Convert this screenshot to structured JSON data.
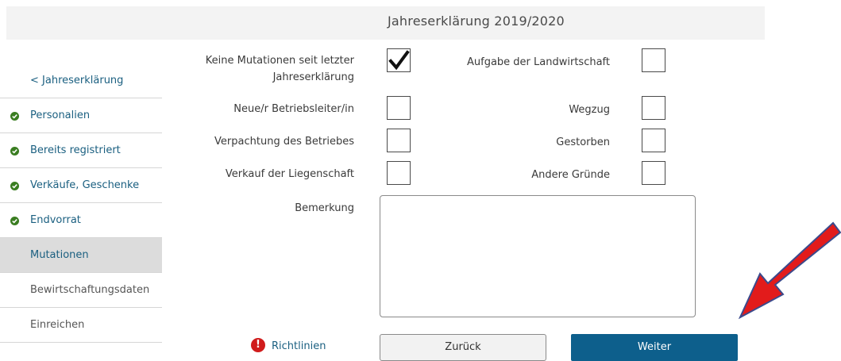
{
  "header": {
    "title": "Jahreserklärung 2019/2020"
  },
  "nav": {
    "back": "< Jahreserklärung",
    "items": [
      {
        "label": "Personalien",
        "state": "done"
      },
      {
        "label": "Bereits registriert",
        "state": "done"
      },
      {
        "label": "Verkäufe, Geschenke",
        "state": "done"
      },
      {
        "label": "Endvorrat",
        "state": "done"
      },
      {
        "label": "Mutationen",
        "state": "active"
      },
      {
        "label": "Bewirtschaftungsdaten",
        "state": "todo"
      },
      {
        "label": "Einreichen",
        "state": "todo"
      }
    ]
  },
  "form": {
    "left": [
      {
        "label_line1": "Keine Mutationen seit letzter",
        "label_line2": "Jahreserklärung",
        "checked": true
      },
      {
        "label": "Neue/r Betriebsleiter/in",
        "checked": false
      },
      {
        "label": "Verpachtung des Betriebes",
        "checked": false
      },
      {
        "label": "Verkauf der Liegenschaft",
        "checked": false
      }
    ],
    "right": [
      {
        "label": "Aufgabe der Landwirtschaft",
        "checked": false
      },
      {
        "label": "Wegzug",
        "checked": false
      },
      {
        "label": "Gestorben",
        "checked": false
      },
      {
        "label": "Andere Gründe",
        "checked": false
      }
    ],
    "remark_label": "Bemerkung",
    "remark_value": ""
  },
  "footer": {
    "guidelines_icon": "!",
    "guidelines": "Richtlinien",
    "back_button": "Zurück",
    "next_button": "Weiter"
  },
  "colors": {
    "link": "#1a5f80",
    "check_green": "#3a7d21",
    "primary_button": "#0d5f8c",
    "annotation_arrow": "#e21b1b"
  }
}
